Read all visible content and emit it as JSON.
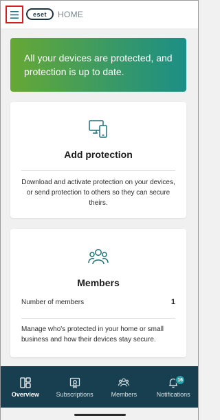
{
  "header": {
    "logo_text": "eset",
    "section_title": "HOME",
    "menu_icon": "hamburger-menu-icon"
  },
  "status_banner": {
    "message": "All your devices are protected, and protection is up to date.",
    "gradient_start": "#66a834",
    "gradient_end": "#1c8e86"
  },
  "add_protection_card": {
    "icon": "devices-icon",
    "title": "Add protection",
    "description": "Download and activate protection on your devices, or send protection to others so they can secure theirs."
  },
  "members_card": {
    "icon": "members-group-icon",
    "title": "Members",
    "count_label": "Number of members",
    "count_value": "1",
    "description": "Manage who's protected in your home or small business and how their devices stay secure."
  },
  "bottom_nav": {
    "background": "#173f4f",
    "items": [
      {
        "label": "Overview",
        "icon": "overview-icon",
        "active": true
      },
      {
        "label": "Subscriptions",
        "icon": "subscriptions-icon",
        "active": false
      },
      {
        "label": "Members",
        "icon": "members-icon",
        "active": false
      },
      {
        "label": "Notifications",
        "icon": "bell-icon",
        "active": false,
        "badge": "16"
      }
    ]
  },
  "colors": {
    "accent_teal": "#1d6f7a",
    "menu_highlight": "#d21f26"
  }
}
